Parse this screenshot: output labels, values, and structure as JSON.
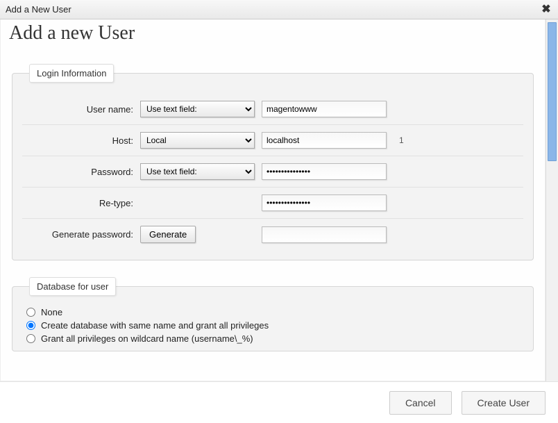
{
  "dialog": {
    "title": "Add a New User"
  },
  "page": {
    "heading": "Add a new User"
  },
  "login_info": {
    "legend": "Login Information",
    "username_label": "User name:",
    "username_select": "Use text field:",
    "username_value": "magentowww",
    "host_label": "Host:",
    "host_select": "Local",
    "host_value": "localhost",
    "host_note": "1",
    "password_label": "Password:",
    "password_select": "Use text field:",
    "password_value": "•••••••••••••••",
    "retype_label": "Re-type:",
    "retype_value": "•••••••••••••••",
    "genpass_label": "Generate password:",
    "genpass_button": "Generate",
    "genpass_value": ""
  },
  "db_for_user": {
    "legend": "Database for user",
    "option_none": "None",
    "option_samename": "Create database with same name and grant all privileges",
    "option_wildcard": "Grant all privileges on wildcard name (username\\_%)",
    "selected": "samename"
  },
  "footer": {
    "cancel": "Cancel",
    "create": "Create User"
  }
}
